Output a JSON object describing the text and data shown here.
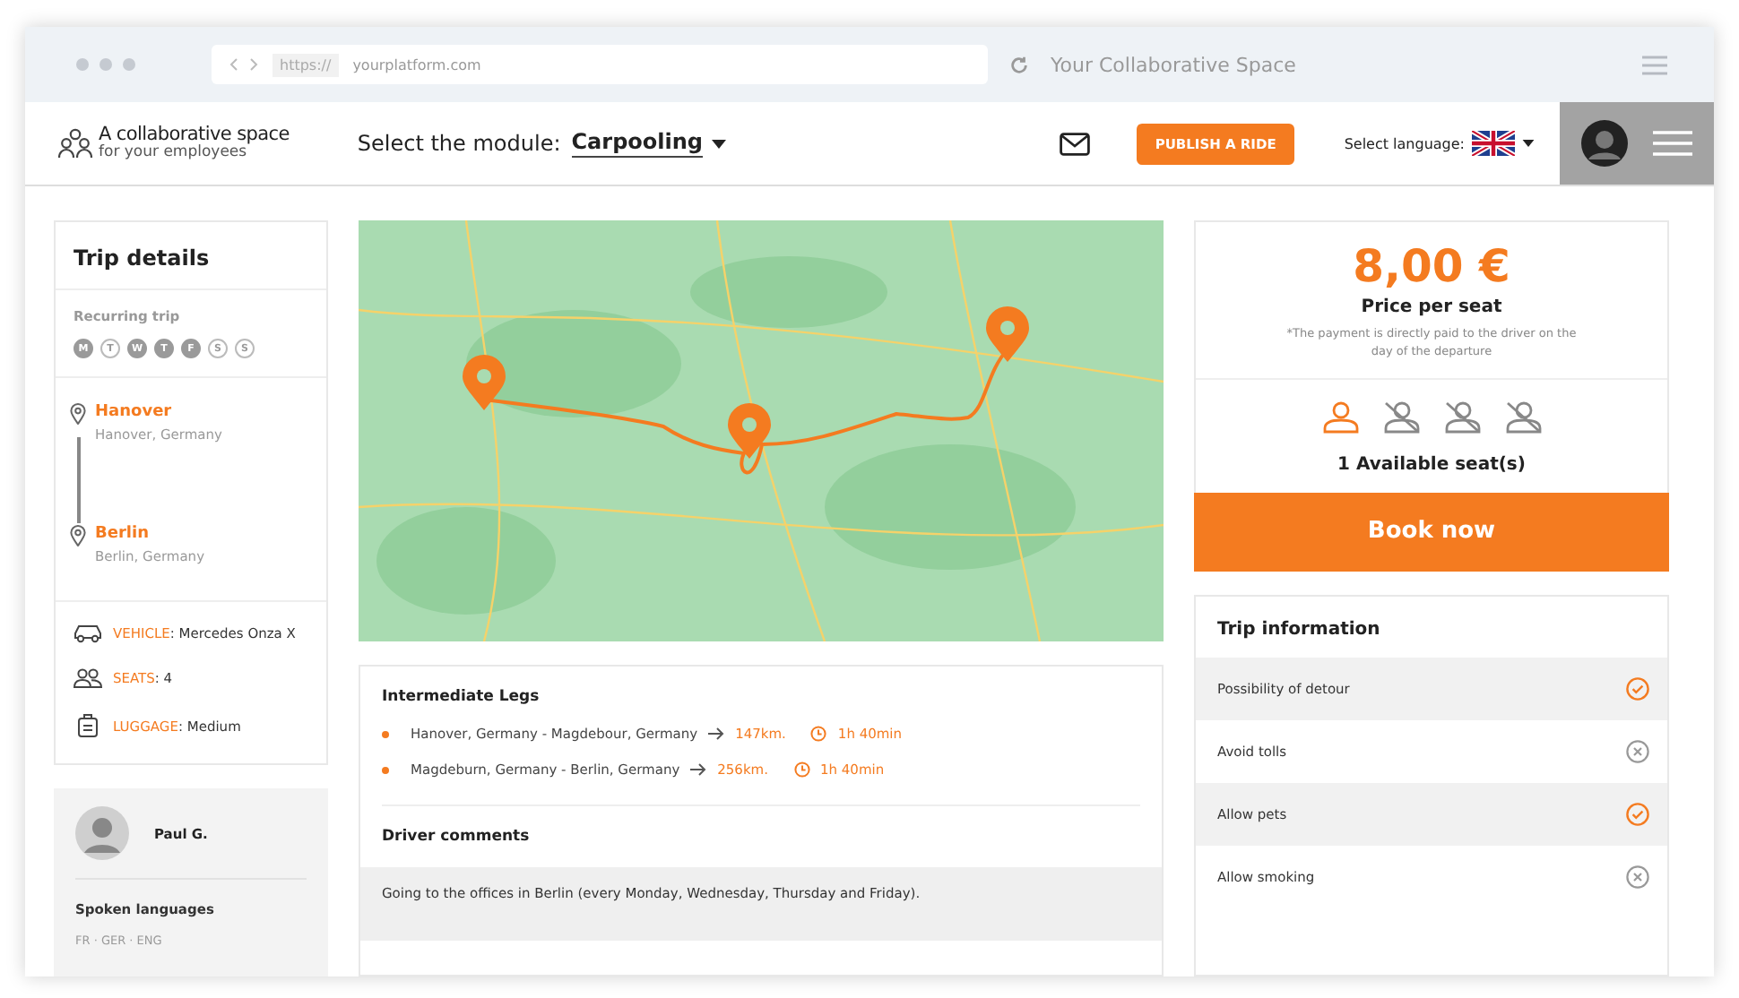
{
  "browser": {
    "protocol": "https://",
    "url": "yourplatform.com",
    "title": "Your Collaborative Space"
  },
  "header": {
    "logo_title": "A collaborative space",
    "logo_subtitle": "for your employees",
    "module_label": "Select the module:",
    "module_value": "Carpooling",
    "publish_button": "PUBLISH A RIDE",
    "language_label": "Select language:"
  },
  "trip": {
    "title": "Trip details",
    "recurring_label": "Recurring trip",
    "days": [
      {
        "label": "M",
        "selected": true
      },
      {
        "label": "T",
        "selected": false
      },
      {
        "label": "W",
        "selected": true
      },
      {
        "label": "T",
        "selected": true
      },
      {
        "label": "F",
        "selected": true
      },
      {
        "label": "S",
        "selected": false
      },
      {
        "label": "S",
        "selected": false
      }
    ],
    "stops": [
      {
        "city": "Hanover",
        "address": "Hanover, Germany"
      },
      {
        "city": "Berlin",
        "address": "Berlin, Germany"
      }
    ],
    "details": [
      {
        "kind": "car",
        "label": "VEHICLE",
        "value": ": Mercedes Onza X"
      },
      {
        "kind": "people",
        "label": "SEATS",
        "value": ": 4"
      },
      {
        "kind": "luggage",
        "label": "LUGGAGE",
        "value": ": Medium"
      }
    ]
  },
  "driver": {
    "name": "Paul G.",
    "languages_title": "Spoken languages",
    "languages": "FR · GER · ENG"
  },
  "legs": {
    "title": "Intermediate Legs",
    "items": [
      {
        "route": "Hanover, Germany - Magdebour, Germany",
        "distance": "147km.",
        "duration": "1h 40min"
      },
      {
        "route": "Magdeburn, Germany - Berlin, Germany",
        "distance": "256km.",
        "duration": "1h 40min"
      }
    ],
    "comments_title": "Driver comments",
    "comment": "Going to the offices in Berlin (every Monday, Wednesday, Thursday and Friday)."
  },
  "price": {
    "amount": "8,00 €",
    "label": "Price per seat",
    "note": "*The payment is directly paid to the driver on the day of the departure",
    "seats": [
      {
        "available": true
      },
      {
        "available": false
      },
      {
        "available": false
      },
      {
        "available": false
      }
    ],
    "available_text": "1 Available seat(s)",
    "book_button": "Book now"
  },
  "trip_information": {
    "title": "Trip information",
    "items": [
      {
        "label": "Possibility of detour",
        "checked": true
      },
      {
        "label": "Avoid tolls",
        "checked": false
      },
      {
        "label": "Allow pets",
        "checked": true
      },
      {
        "label": "Allow smoking",
        "checked": false
      }
    ]
  }
}
